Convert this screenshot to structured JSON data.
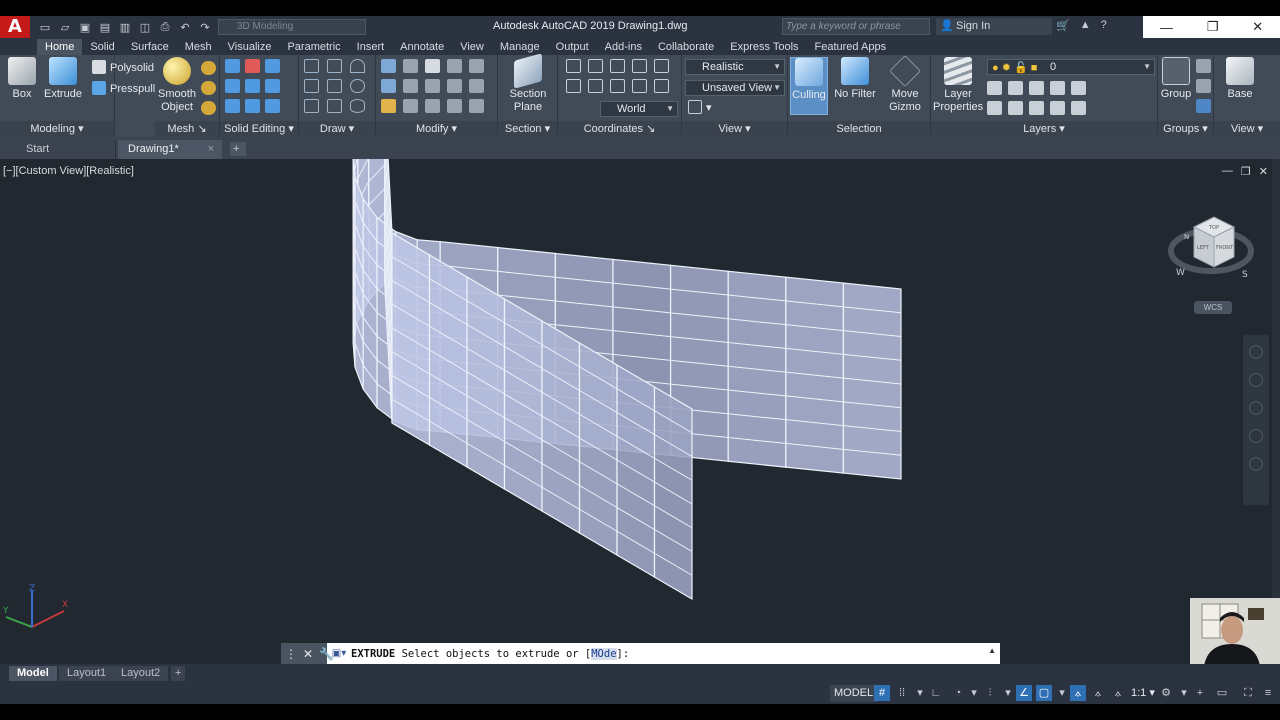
{
  "window": {
    "title": "Autodesk AutoCAD 2019    Drawing1.dwg",
    "app_logo": "A",
    "workspace": "3D Modeling",
    "search_placeholder": "Type a keyword or phrase",
    "sign_in": "Sign In"
  },
  "ribbon_tabs": [
    "Home",
    "Solid",
    "Surface",
    "Mesh",
    "Visualize",
    "Parametric",
    "Insert",
    "Annotate",
    "View",
    "Manage",
    "Output",
    "Add-ins",
    "Collaborate",
    "Express Tools",
    "Featured Apps"
  ],
  "ribbon": {
    "modeling": {
      "title": "Modeling",
      "box": "Box",
      "extrude": "Extrude",
      "polysolid": "Polysolid",
      "presspull": "Presspull"
    },
    "mesh": {
      "title": "Mesh",
      "smooth_object_1": "Smooth",
      "smooth_object_2": "Object"
    },
    "solid_editing": {
      "title": "Solid Editing"
    },
    "draw": {
      "title": "Draw"
    },
    "modify": {
      "title": "Modify"
    },
    "section": {
      "title": "Section",
      "section_plane_1": "Section",
      "section_plane_2": "Plane"
    },
    "coordinates": {
      "title": "Coordinates",
      "ucs": "World"
    },
    "view": {
      "title": "View",
      "visual_style": "Realistic",
      "named_view": "Unsaved View"
    },
    "selection": {
      "title": "Selection",
      "culling": "Culling",
      "no_filter": "No Filter",
      "move_gizmo_1": "Move",
      "move_gizmo_2": "Gizmo"
    },
    "layers": {
      "title": "Layers",
      "layer_properties_1": "Layer",
      "layer_properties_2": "Properties",
      "current_layer": "0"
    },
    "groups": {
      "title": "Groups",
      "group": "Group"
    },
    "view2": {
      "title": "View",
      "base": "Base"
    }
  },
  "doc_tabs": {
    "start": "Start",
    "drawing": "Drawing1*",
    "close": "×",
    "new": "+"
  },
  "viewport": {
    "label": "[−][Custom View][Realistic]",
    "viewcube": {
      "top": "TOP",
      "left": "LEFT",
      "front": "FRONT",
      "w": "W",
      "s": "S",
      "n": "N"
    },
    "wcs": "WCS",
    "ucs_x": "X",
    "ucs_y": "Y",
    "ucs_z": "Z"
  },
  "command": {
    "keyword": "EXTRUDE",
    "prompt": " Select objects to extrude or [",
    "option": "MOde",
    "suffix": "]:"
  },
  "layout_tabs": {
    "model": "Model",
    "layout1": "Layout1",
    "layout2": "Layout2",
    "new": "+"
  },
  "status": {
    "model": "MODEL",
    "scale": "1:1"
  },
  "colors": {
    "accent": "#2f6fb3",
    "logo_red": "#c41a1a",
    "viewport_bg": "#212830"
  }
}
